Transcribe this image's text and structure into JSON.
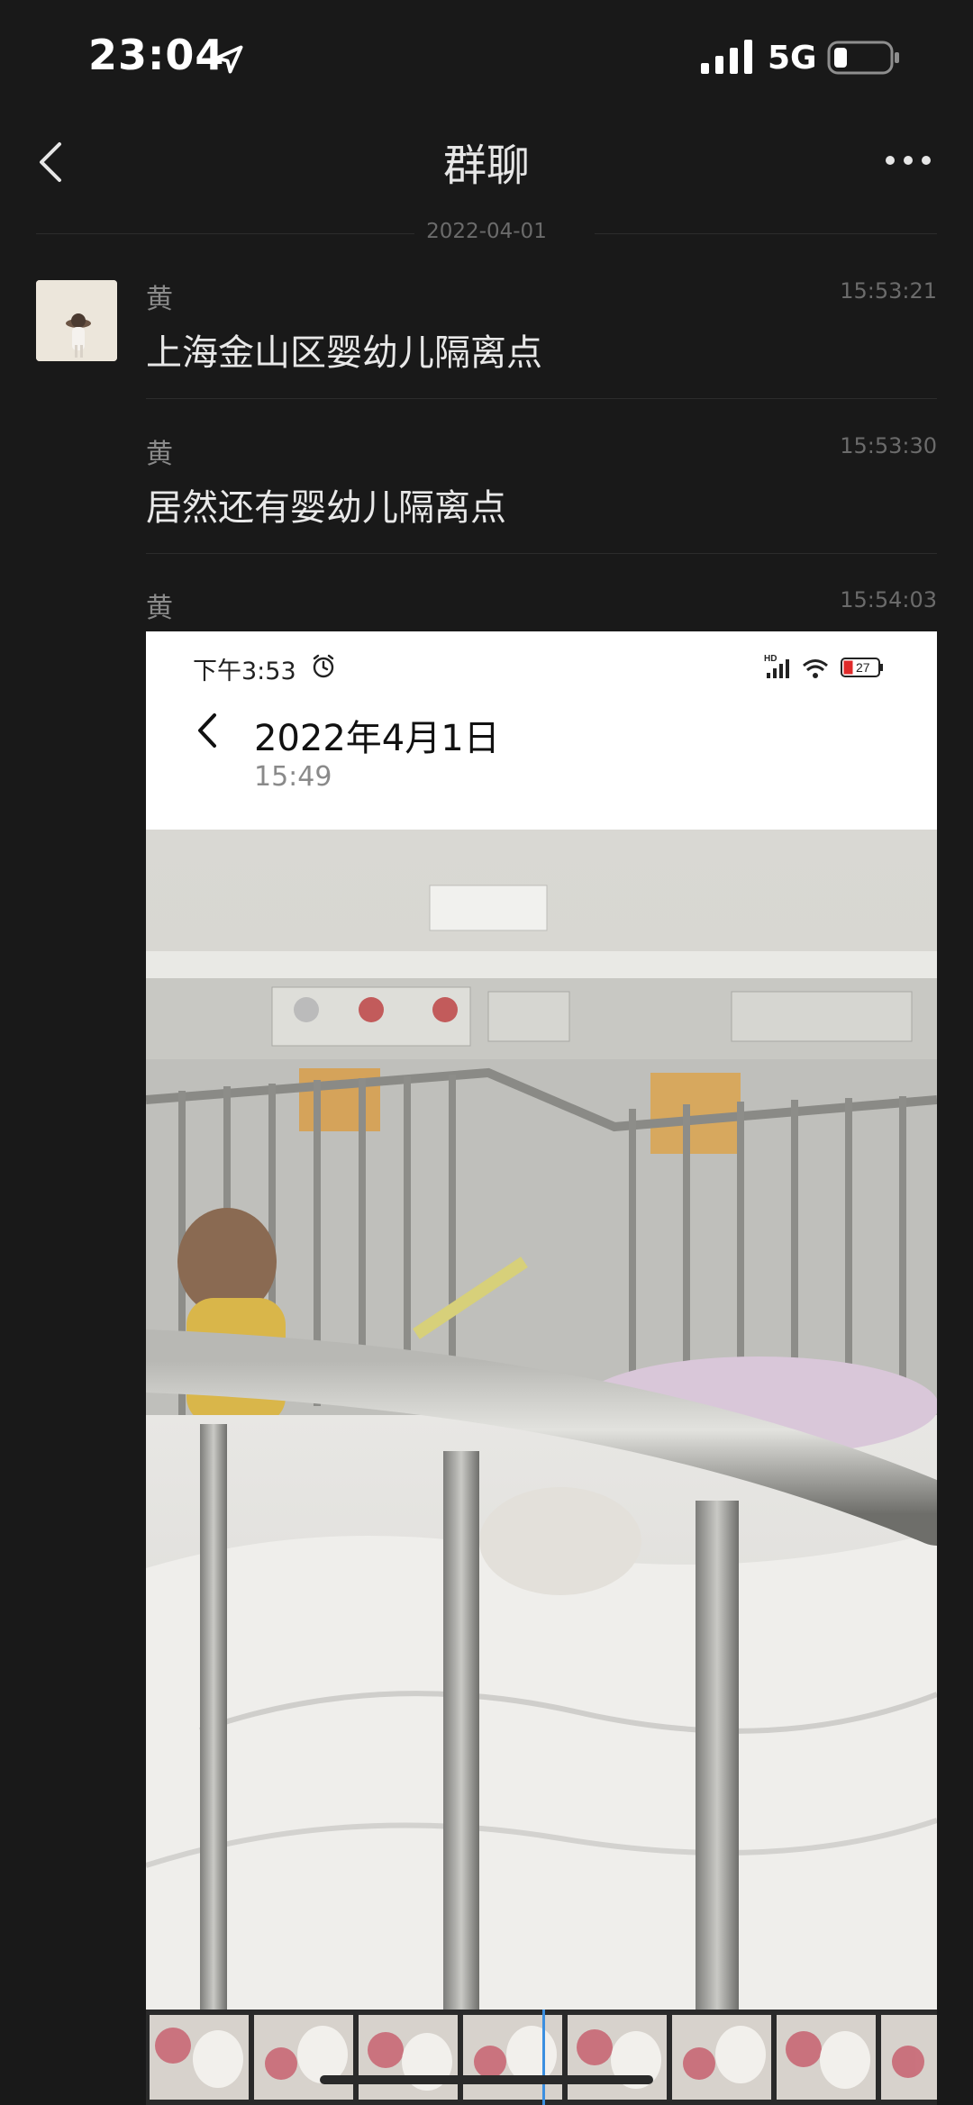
{
  "status_bar": {
    "time": "23:04",
    "network": "5G",
    "icons": [
      "location-arrow-icon",
      "signal-bars-icon",
      "battery-low-icon"
    ]
  },
  "nav": {
    "title": "群聊",
    "icons": [
      "back-chevron-icon",
      "more-dots-icon"
    ]
  },
  "date_separator": "2022-04-01",
  "messages": [
    {
      "sender": "黄",
      "time": "15:53:21",
      "text": "上海金山区婴幼儿隔离点"
    },
    {
      "sender": "黄",
      "time": "15:53:30",
      "text": "居然还有婴幼儿隔离点"
    },
    {
      "sender": "黄",
      "time": "15:54:03",
      "type": "image"
    }
  ],
  "shared_image": {
    "status_time": "下午3:53",
    "battery_level": "27",
    "date_title": "2022年4月1日",
    "sub_time": "15:49",
    "icons": [
      "alarm-clock-icon",
      "hd-signal-icon",
      "wifi-icon",
      "battery-icon",
      "back-chevron-icon"
    ]
  },
  "colors": {
    "background": "#191919",
    "text_primary": "#e6e6e6",
    "text_secondary": "#8a8a8a"
  }
}
